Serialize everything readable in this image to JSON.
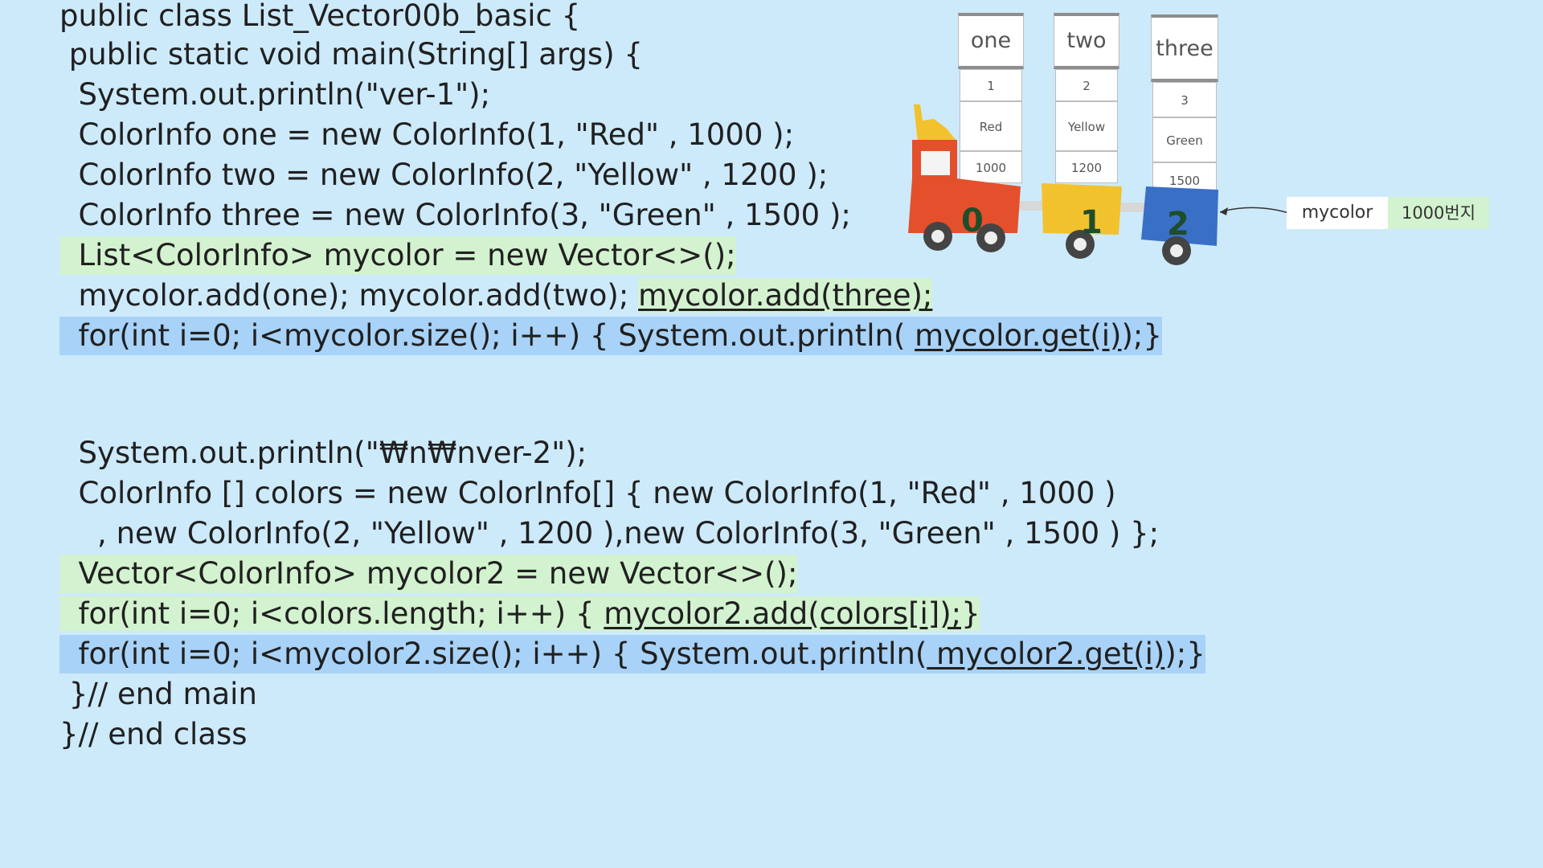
{
  "code": {
    "l1": "public class List_Vector00b_basic {",
    "l2": " public static void main(String[] args) {",
    "l3": "  System.out.println(\"ver-1\");",
    "l4": "  ColorInfo one = new ColorInfo(1, \"Red\" , 1000 );",
    "l5": "  ColorInfo two = new ColorInfo(2, \"Yellow\" , 1200 );",
    "l6": "  ColorInfo three = new ColorInfo(3, \"Green\" , 1500 );",
    "l7": "  List<ColorInfo> mycolor = new Vector<>();",
    "l8a": "  mycolor.add(one); mycolor.add(two); ",
    "l8b": "mycolor.add(three);",
    "l9a": "  for(int i=0; i<mycolor.size(); i++) { System.out.println( ",
    "l9b": "mycolor.get(i)",
    "l9c": ");}",
    "l10": "  System.out.println(\"₩n₩nver-2\");",
    "l11": "  ColorInfo [] colors = new ColorInfo[] { new ColorInfo(1, \"Red\" , 1000 )",
    "l12": "    , new ColorInfo(2, \"Yellow\" , 1200 ),new ColorInfo(3, \"Green\" , 1500 ) };",
    "l13": "  Vector<ColorInfo> mycolor2 = new Vector<>();",
    "l14a": "  for(int i=0; i<colors.length; i++) { ",
    "l14b": "mycolor2.add(colors[i]);",
    "l14c": "}",
    "l15a": "  for(int i=0; i<mycolor2.size(); i++) { System.out.println(",
    "l15b": " mycolor2.get(i)",
    "l15c": ");}",
    "l16": " }// end main",
    "l17": "}// end class"
  },
  "objects": [
    {
      "name": "one",
      "num": "1",
      "color": "Red",
      "price": "1000"
    },
    {
      "name": "two",
      "num": "2",
      "color": "Yellow",
      "price": "1200"
    },
    {
      "name": "three",
      "num": "3",
      "color": "Green",
      "price": "1500"
    }
  ],
  "train": {
    "indices": [
      "0",
      "1",
      "2"
    ],
    "colors": {
      "engine": "#e4502b",
      "car1": "#f2c22e",
      "car2": "#3a6fc6"
    }
  },
  "reference": {
    "label": "mycolor",
    "address": "1000번지"
  }
}
